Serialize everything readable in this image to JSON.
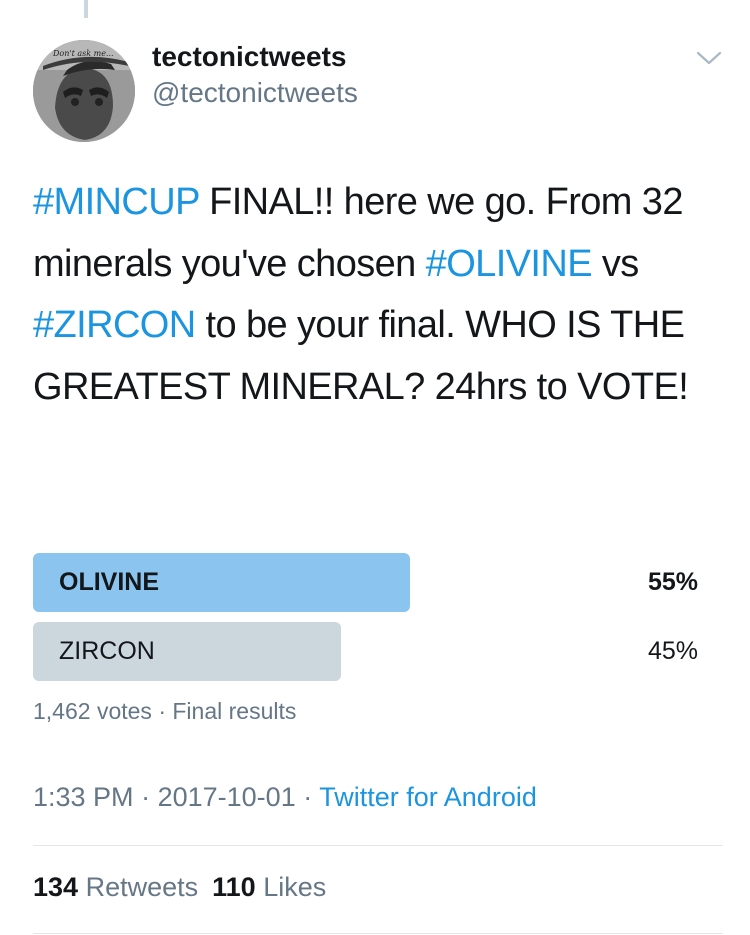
{
  "user": {
    "display_name": "tectonictweets",
    "handle": "@tectonictweets",
    "avatar_caption": "Don't ask me..."
  },
  "tweet": {
    "segments": [
      {
        "text": "#MINCUP",
        "hashtag": true
      },
      {
        "text": " FINAL!! here we go. From 32 minerals you've chosen ",
        "hashtag": false
      },
      {
        "text": "#OLIVINE",
        "hashtag": true
      },
      {
        "text": " vs ",
        "hashtag": false
      },
      {
        "text": "#ZIRCON",
        "hashtag": true
      },
      {
        "text": " to be your final. WHO IS THE GREATEST MINERAL? 24hrs to VOTE!",
        "hashtag": false
      }
    ]
  },
  "poll": {
    "options": [
      {
        "label": "OLIVINE",
        "percent_label": "55%",
        "percent": 55,
        "winner": true
      },
      {
        "label": "ZIRCON",
        "percent_label": "45%",
        "percent": 45,
        "winner": false
      }
    ],
    "votes": "1,462 votes",
    "separator": "·",
    "status": "Final results"
  },
  "meta": {
    "time": "1:33 PM",
    "separator": "·",
    "date": "2017-10-01",
    "source": "Twitter for Android"
  },
  "stats": {
    "retweets_count": "134",
    "retweets_label": "Retweets",
    "likes_count": "110",
    "likes_label": "Likes"
  },
  "colors": {
    "text": "#14171a",
    "secondary": "#657786",
    "link": "#1b95e0",
    "poll_winner": "#8cc4f0",
    "poll_other": "#ccd6dd",
    "divider": "#e1e8ed"
  },
  "icons": {
    "caret": "chevron-down-icon"
  }
}
